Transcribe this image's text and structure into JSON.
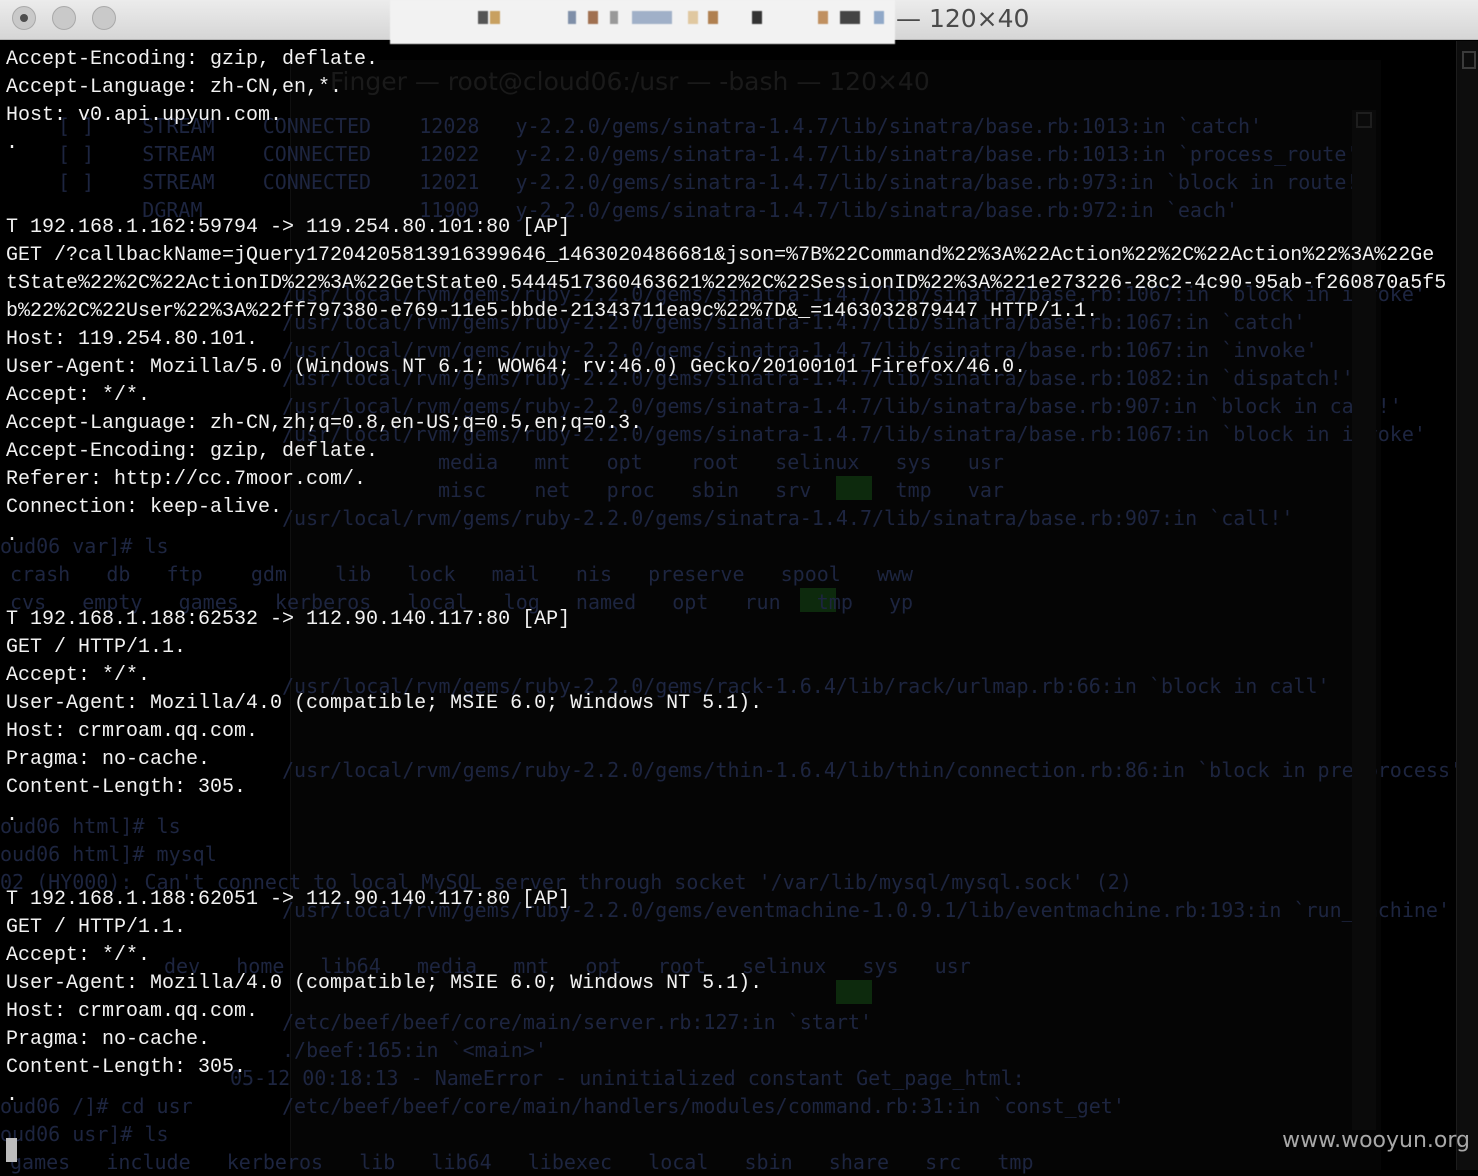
{
  "window": {
    "title_suffix": "— 120×40",
    "background_title": "Finger — root@cloud06:/usr — -bash — 120×40"
  },
  "background_lines": [
    "[ ]    STREAM    CONNECTED    12028   y-2.2.0/gems/sinatra-1.4.7/lib/sinatra/base.rb:1013:in `catch'",
    "[ ]    STREAM    CONNECTED    12022   y-2.2.0/gems/sinatra-1.4.7/lib/sinatra/base.rb:1013:in `process_route'",
    "[ ]    STREAM    CONNECTED    12021   y-2.2.0/gems/sinatra-1.4.7/lib/sinatra/base.rb:973:in `block in route!'",
    "       DGRAM                  11909   y-2.2.0/gems/sinatra-1.4.7/lib/sinatra/base.rb:972:in `each'",
    "/usr/local/rvm/gems/ruby-2.2.0/gems/sinatra-1.4.7/lib/sinatra/base.rb:1067:in `block in invoke'",
    "/usr/local/rvm/gems/ruby-2.2.0/gems/sinatra-1.4.7/lib/sinatra/base.rb:1067:in `catch'",
    "/usr/local/rvm/gems/ruby-2.2.0/gems/sinatra-1.4.7/lib/sinatra/base.rb:1067:in `invoke'",
    "/usr/local/rvm/gems/ruby-2.2.0/gems/sinatra-1.4.7/lib/sinatra/base.rb:1082:in `dispatch!'",
    "/usr/local/rvm/gems/ruby-2.2.0/gems/sinatra-1.4.7/lib/sinatra/base.rb:907:in `block in call!'",
    "/usr/local/rvm/gems/ruby-2.2.0/gems/sinatra-1.4.7/lib/sinatra/base.rb:1067:in `block in invoke'",
    "media   mnt   opt    root   selinux   sys   usr",
    "misc    net   proc   sbin   srv       tmp   var",
    "/usr/local/rvm/gems/ruby-2.2.0/gems/sinatra-1.4.7/lib/sinatra/base.rb:907:in `call!'",
    "oud06 var]# ls",
    "crash   db   ftp    gdm    lib   lock   mail   nis   preserve   spool   www",
    "cvs   empty   games   kerberos   local   log   named   opt   run   tmp   yp",
    "/usr/local/rvm/gems/ruby-2.2.0/gems/rack-1.6.4/lib/rack/urlmap.rb:66:in `block in call'",
    "/usr/local/rvm/gems/ruby-2.2.0/gems/thin-1.6.4/lib/thin/connection.rb:86:in `block in pre_process'",
    "oud06 html]# ls",
    "oud06 html]# mysql",
    "02 (HY000): Can't connect to local MySQL server through socket '/var/lib/mysql/mysql.sock' (2)",
    "/usr/local/rvm/gems/ruby-2.2.0/gems/eventmachine-1.0.9.1/lib/eventmachine.rb:193:in `run_machine'",
    "dev   home   lib64   media   mnt   opt   root   selinux   sys   usr",
    "/etc/beef/beef/core/main/server.rb:127:in `start'",
    "./beef:165:in `<main>'",
    "05-12 00:18:13 - NameError - uninitialized constant Get_page_html:",
    "/etc/beef/beef/core/main/handlers/modules/command.rb:31:in `const_get'",
    "oud06 /]# cd usr",
    "oud06 usr]# ls",
    "games   include   kerberos   lib   lib64   libexec   local   sbin   share   src   tmp"
  ],
  "terminal_lines": [
    "Accept-Encoding: gzip, deflate.",
    "Accept-Language: zh-CN,en,*.",
    "Host: v0.api.upyun.com.",
    ".",
    "",
    "",
    "T 192.168.1.162:59794 -> 119.254.80.101:80 [AP]",
    "GET /?callbackName=jQuery17204205813916399646_1463020486681&json=%7B%22Command%22%3A%22Action%22%2C%22Action%22%3A%22Ge",
    "tState%22%2C%22ActionID%22%3A%22GetState0.5444517360463621%22%2C%22SessionID%22%3A%221e273226-28c2-4c90-95ab-f260870a5f5",
    "b%22%2C%22User%22%3A%22ff797380-e769-11e5-bbde-21343711ea9c%22%7D&_=1463032879447 HTTP/1.1.",
    "Host: 119.254.80.101.",
    "User-Agent: Mozilla/5.0 (Windows NT 6.1; WOW64; rv:46.0) Gecko/20100101 Firefox/46.0.",
    "Accept: */*.",
    "Accept-Language: zh-CN,zh;q=0.8,en-US;q=0.5,en;q=0.3.",
    "Accept-Encoding: gzip, deflate.",
    "Referer: http://cc.7moor.com/.",
    "Connection: keep-alive.",
    ".",
    "",
    "",
    "T 192.168.1.188:62532 -> 112.90.140.117:80 [AP]",
    "GET / HTTP/1.1.",
    "Accept: */*.",
    "User-Agent: Mozilla/4.0 (compatible; MSIE 6.0; Windows NT 5.1).",
    "Host: crmroam.qq.com.",
    "Pragma: no-cache.",
    "Content-Length: 305.",
    ".",
    "",
    "",
    "T 192.168.1.188:62051 -> 112.90.140.117:80 [AP]",
    "GET / HTTP/1.1.",
    "Accept: */*.",
    "User-Agent: Mozilla/4.0 (compatible; MSIE 6.0; Windows NT 5.1).",
    "Host: crmroam.qq.com.",
    "Pragma: no-cache.",
    "Content-Length: 305.",
    "."
  ],
  "watermark": "www.wooyun.org",
  "colors": {
    "terminal_bg": "#000000",
    "terminal_fg": "#f2f2f2",
    "ghost_fg": "#1d2540",
    "titlebar": "#e4e4e4"
  },
  "icons": [
    "close-icon",
    "minimize-icon",
    "zoom-icon",
    "scrollbar-grip-icon"
  ]
}
